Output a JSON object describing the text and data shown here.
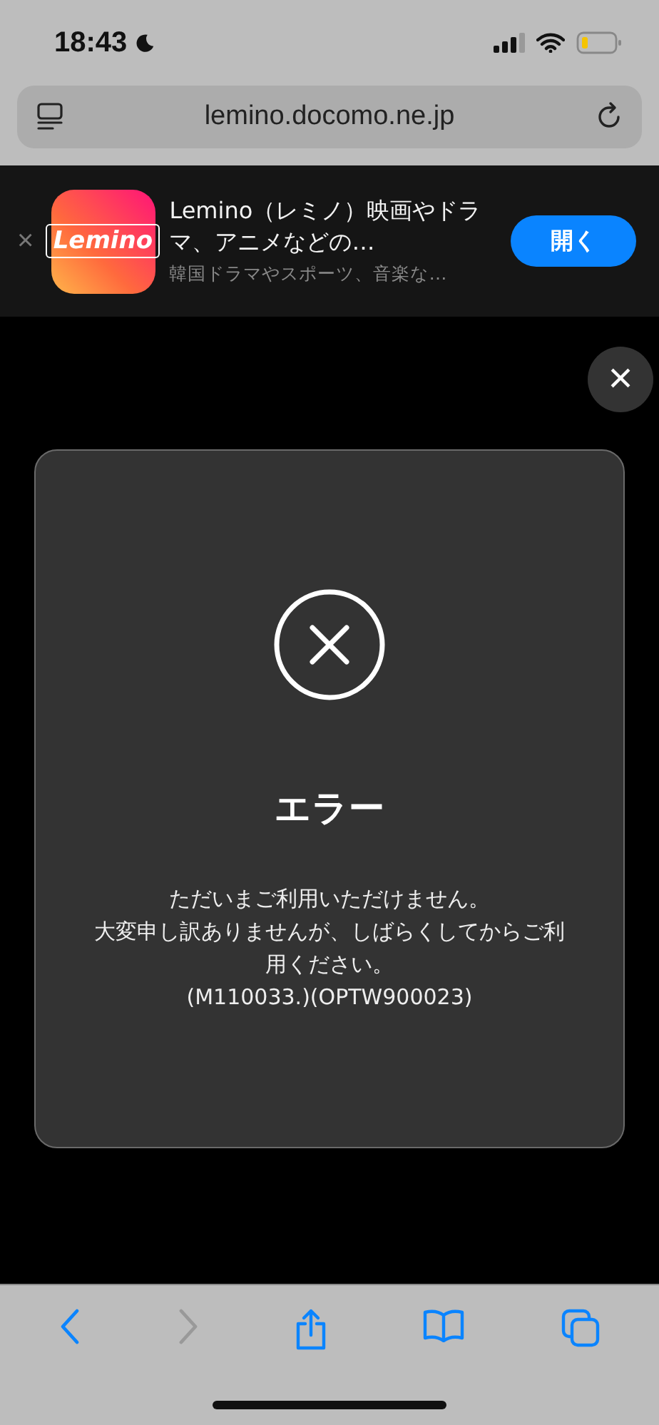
{
  "status_bar": {
    "time": "18:43"
  },
  "address_bar": {
    "url": "lemino.docomo.ne.jp"
  },
  "app_banner": {
    "close": "×",
    "logo_text": "Lemino",
    "title": "Lemino（レミノ）映画やドラマ、アニメなどの…",
    "subtitle": "韓国ドラマやスポーツ、音楽な…",
    "button": "開く"
  },
  "dialog": {
    "close": "×",
    "title": "エラー",
    "message_lines": [
      "ただいまご利用いただけません。",
      "大変申し訳ありませんが、しばらくしてからご利用ください。",
      "(M110033.)(OPTW900023)"
    ]
  },
  "toolbar": [
    {
      "kind": "back",
      "disabled": false
    },
    {
      "kind": "forward",
      "disabled": true
    },
    {
      "kind": "share",
      "disabled": false
    },
    {
      "kind": "bookmarks",
      "disabled": false
    },
    {
      "kind": "tabs",
      "disabled": false
    }
  ]
}
